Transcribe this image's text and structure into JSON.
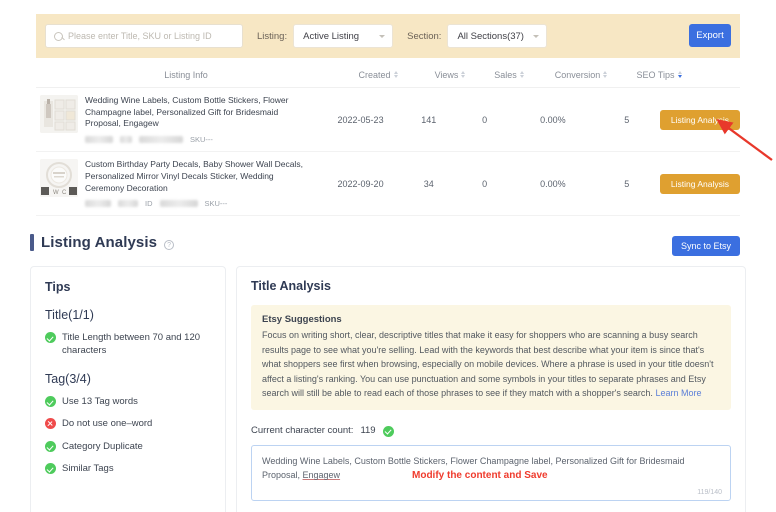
{
  "toolbar": {
    "search_placeholder": "Please enter Title, SKU or Listing ID",
    "search_value": "",
    "listing_label": "Listing:",
    "listing_value": "Active Listing",
    "section_label": "Section:",
    "section_value": "All Sections(37)",
    "export_label": "Export"
  },
  "table": {
    "headers": {
      "info": "Listing Info",
      "created": "Created",
      "views": "Views",
      "sales": "Sales",
      "conversion": "Conversion",
      "seo": "SEO Tips"
    },
    "rows": [
      {
        "title": "Wedding Wine Labels, Custom Bottle Stickers, Flower Champagne label, Personalized Gift for Bridesmaid Proposal, Engagew",
        "id_label": "",
        "sku": "SKU---",
        "created": "2022-05-23",
        "views": "141",
        "sales": "0",
        "conversion": "0.00%",
        "seo": "5",
        "action": "Listing Analysis"
      },
      {
        "title": "Custom Birthday Party Decals, Baby Shower Wall Decals, Personalized Mirror Vinyl Decals Sticker, Wedding Ceremony Decoration",
        "id_label": "ID",
        "sku": "SKU---",
        "created": "2022-09-20",
        "views": "34",
        "sales": "0",
        "conversion": "0.00%",
        "seo": "5",
        "action": "Listing Analysis"
      }
    ]
  },
  "section": {
    "title": "Listing Analysis",
    "sync_label": "Sync to Etsy"
  },
  "tips": {
    "heading": "Tips",
    "title_group": "Title(1/1)",
    "title_items": [
      {
        "status": "ok",
        "text": "Title Length between 70 and 120 characters"
      }
    ],
    "tag_group": "Tag(3/4)",
    "tag_items": [
      {
        "status": "ok",
        "text": "Use 13 Tag words"
      },
      {
        "status": "bad",
        "text": "Do not use one–word"
      },
      {
        "status": "ok",
        "text": "Category Duplicate"
      },
      {
        "status": "ok",
        "text": "Similar Tags"
      }
    ]
  },
  "title_analysis": {
    "heading": "Title Analysis",
    "suggestions_heading": "Etsy Suggestions",
    "suggestions_text": "Focus on writing short, clear, descriptive titles that make it easy for shoppers who are scanning a busy search results page to see what you're selling. Lead with the keywords that best describe what your item is since that's what shoppers see first when browsing, especially on mobile devices. Where a phrase is used in your title doesn't affect a listing's ranking. You can use punctuation and some symbols in your titles to separate phrases and Etsy search will still be able to read each of those phrases to see if they match with a shopper's search.",
    "learn_more": "Learn More",
    "char_count_label": "Current character count:",
    "char_count_value": "119",
    "editor_value": "Wedding Wine Labels, Custom Bottle Stickers, Flower Champagne label, Personalized Gift for Bridesmaid Proposal, Engagew",
    "editor_highlight_word": "Engagew",
    "editor_counter": "119/140",
    "annotation": "Modify the content and Save"
  },
  "colors": {
    "toolbar_bg": "#f7e7c4",
    "primary_blue": "#3b6fe0",
    "action_orange": "#dfa030",
    "suggestion_bg": "#fbf6e3",
    "ok_green": "#4ecb5c",
    "bad_red": "#ef4b4b",
    "annotation_red": "#ef3b2d"
  }
}
